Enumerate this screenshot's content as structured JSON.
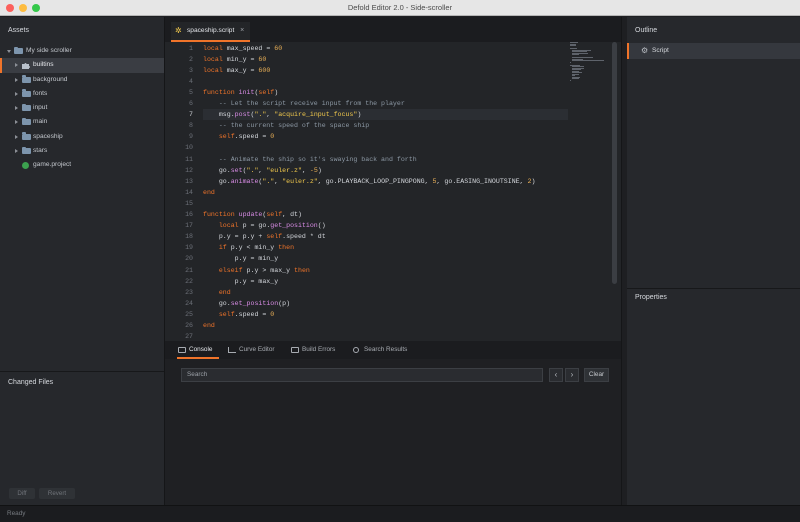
{
  "window": {
    "title": "Defold Editor 2.0 - Side-scroller"
  },
  "assets": {
    "header": "Assets",
    "root": "My side scroller",
    "items": [
      {
        "label": "builtins",
        "selected": true,
        "icon": "puzzle-icon"
      },
      {
        "label": "background",
        "icon": "folder-icon"
      },
      {
        "label": "fonts",
        "icon": "folder-icon"
      },
      {
        "label": "input",
        "icon": "folder-icon"
      },
      {
        "label": "main",
        "icon": "folder-icon"
      },
      {
        "label": "spaceship",
        "icon": "folder-icon"
      },
      {
        "label": "stars",
        "icon": "folder-icon"
      },
      {
        "label": "game.project",
        "icon": "project-icon"
      }
    ]
  },
  "changed_files": {
    "header": "Changed Files",
    "diff_label": "Diff",
    "revert_label": "Revert"
  },
  "editor": {
    "tab_label": "spaceship.script",
    "tab_close": "×",
    "active_line": 7,
    "lines": [
      [
        [
          "k",
          "local"
        ],
        [
          "t",
          " max_speed = "
        ],
        [
          "n",
          "60"
        ]
      ],
      [
        [
          "k",
          "local"
        ],
        [
          "t",
          " min_y = "
        ],
        [
          "n",
          "60"
        ]
      ],
      [
        [
          "k",
          "local"
        ],
        [
          "t",
          " max_y = "
        ],
        [
          "n",
          "600"
        ]
      ],
      [],
      [
        [
          "k",
          "function"
        ],
        [
          "t",
          " "
        ],
        [
          "f",
          "init"
        ],
        [
          "t",
          "("
        ],
        [
          "k",
          "self"
        ],
        [
          "t",
          ")"
        ]
      ],
      [
        [
          "t",
          "    "
        ],
        [
          "c",
          "-- Let the script receive input from the player"
        ]
      ],
      [
        [
          "t",
          "    msg."
        ],
        [
          "f",
          "post"
        ],
        [
          "t",
          "("
        ],
        [
          "s",
          "\".\""
        ],
        [
          "t",
          ", "
        ],
        [
          "s",
          "\"acquire_input_focus\""
        ],
        [
          "t",
          ")"
        ]
      ],
      [
        [
          "t",
          "    "
        ],
        [
          "c",
          "-- the current speed of the space ship"
        ]
      ],
      [
        [
          "t",
          "    "
        ],
        [
          "k",
          "self"
        ],
        [
          "t",
          ".speed = "
        ],
        [
          "n",
          "0"
        ]
      ],
      [],
      [
        [
          "t",
          "    "
        ],
        [
          "c",
          "-- Animate the ship so it's swaying back and forth"
        ]
      ],
      [
        [
          "t",
          "    go."
        ],
        [
          "f",
          "set"
        ],
        [
          "t",
          "("
        ],
        [
          "s",
          "\".\""
        ],
        [
          "t",
          ", "
        ],
        [
          "s",
          "\"euler.z\""
        ],
        [
          "t",
          ", "
        ],
        [
          "n",
          "-5"
        ],
        [
          "t",
          ")"
        ]
      ],
      [
        [
          "t",
          "    go."
        ],
        [
          "f",
          "animate"
        ],
        [
          "t",
          "("
        ],
        [
          "s",
          "\".\""
        ],
        [
          "t",
          ", "
        ],
        [
          "s",
          "\"euler.z\""
        ],
        [
          "t",
          ", go.PLAYBACK_LOOP_PINGPONG, "
        ],
        [
          "n",
          "5"
        ],
        [
          "t",
          ", go.EASING_INOUTSINE, "
        ],
        [
          "n",
          "2"
        ],
        [
          "t",
          ")"
        ]
      ],
      [
        [
          "k",
          "end"
        ]
      ],
      [],
      [
        [
          "k",
          "function"
        ],
        [
          "t",
          " "
        ],
        [
          "f",
          "update"
        ],
        [
          "t",
          "("
        ],
        [
          "k",
          "self"
        ],
        [
          "t",
          ", dt)"
        ]
      ],
      [
        [
          "t",
          "    "
        ],
        [
          "k",
          "local"
        ],
        [
          "t",
          " p = go."
        ],
        [
          "f",
          "get_position"
        ],
        [
          "t",
          "()"
        ]
      ],
      [
        [
          "t",
          "    p.y = p.y + "
        ],
        [
          "k",
          "self"
        ],
        [
          "t",
          ".speed * dt"
        ]
      ],
      [
        [
          "t",
          "    "
        ],
        [
          "k",
          "if"
        ],
        [
          "t",
          " p.y < min_y "
        ],
        [
          "k",
          "then"
        ]
      ],
      [
        [
          "t",
          "        p.y = min_y"
        ]
      ],
      [
        [
          "t",
          "    "
        ],
        [
          "k",
          "elseif"
        ],
        [
          "t",
          " p.y > max_y "
        ],
        [
          "k",
          "then"
        ]
      ],
      [
        [
          "t",
          "        p.y = max_y"
        ]
      ],
      [
        [
          "t",
          "    "
        ],
        [
          "k",
          "end"
        ]
      ],
      [
        [
          "t",
          "    go."
        ],
        [
          "f",
          "set_position"
        ],
        [
          "t",
          "(p)"
        ]
      ],
      [
        [
          "t",
          "    "
        ],
        [
          "k",
          "self"
        ],
        [
          "t",
          ".speed = "
        ],
        [
          "n",
          "0"
        ]
      ],
      [
        [
          "k",
          "end"
        ]
      ],
      []
    ]
  },
  "bottom_panel": {
    "tabs": [
      {
        "label": "Console",
        "active": true
      },
      {
        "label": "Curve Editor"
      },
      {
        "label": "Build Errors"
      },
      {
        "label": "Search Results"
      }
    ],
    "search_placeholder": "Search",
    "prev_label": "‹",
    "next_label": "›",
    "clear_label": "Clear"
  },
  "outline": {
    "header": "Outline",
    "item": "Script",
    "item_icon": "gear-icon"
  },
  "properties": {
    "header": "Properties"
  },
  "status": {
    "text": "Ready"
  },
  "colors": {
    "accent": "#f0742a",
    "keyword": "#f0742a",
    "string": "#f2c94c",
    "comment": "#8c98a4",
    "function": "#d98ce6"
  }
}
